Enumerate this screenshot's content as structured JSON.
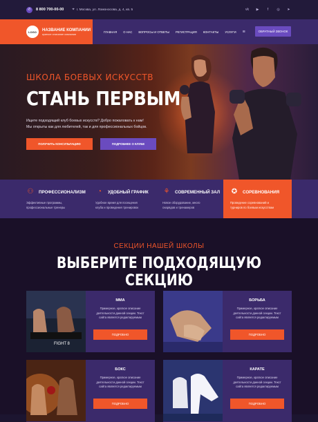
{
  "topbar": {
    "phone": "8 800 700-00-00",
    "address": "г. Москва, ул. Ломоносова, д. 4, кв. 5",
    "socials": [
      "vk-icon",
      "youtube-icon",
      "facebook-icon",
      "instagram-icon",
      "telegram-icon"
    ]
  },
  "brand": {
    "logo": "LOGO",
    "name": "НАЗВАНИЕ КОМПАНИИ",
    "tagline": "краткое описание компании"
  },
  "menu": {
    "items": [
      "ГЛАВНАЯ",
      "О НАС",
      "ВОПРОСЫ И ОТВЕТЫ",
      "РЕГИСТРАЦИЯ",
      "КОНТАКТЫ",
      "УСЛУГИ"
    ],
    "callback": "ОБРАТНЫЙ ЗВОНОК"
  },
  "hero": {
    "kicker": "ШКОЛА БОЕВЫХ ИСКУССТВ",
    "title": "СТАНЬ ПЕРВЫМ",
    "text_line1": "Ищете подходящий клуб боевых искусств? Добро пожаловать к нам!",
    "text_line2": "Мы открыты как для любителей, так и для профессиональных бойцов.",
    "btn_primary": "ПОЛУЧИТЬ КОНСУЛЬТАЦИЮ",
    "btn_secondary": "ПОДРОБНЕЕ О КЛУБЕ"
  },
  "features": [
    {
      "title": "ПРОФЕССИОНАЛИЗМ",
      "line1": "Эффективные программы,",
      "line2": "профессиональные тренеры"
    },
    {
      "title": "УДОБНЫЙ ГРАФИК",
      "line1": "Удобное время для посещения",
      "line2": "клуба и проведения тренировок"
    },
    {
      "title": "СОВРЕМЕННЫЙ ЗАЛ",
      "line1": "Новое оборудование, много",
      "line2": "снарядов и тренажеров"
    },
    {
      "title": "СОРЕВНОВАНИЯ",
      "line1": "Проведение соревнований и",
      "line2": "турниров по боевым искусствам"
    }
  ],
  "sections": {
    "kicker": "СЕКЦИИ НАШЕЙ ШКОЛЫ",
    "title": "ВЫБЕРИТЕ ПОДХОДЯЩУЮ СЕКЦИЮ",
    "cards": [
      {
        "title": "ММА",
        "line1": "Примерное, краткое описание",
        "line2": "деятельности данной секции. Текст",
        "line3": "сайта является редактируемым",
        "button": "ПОДРОБНО"
      },
      {
        "title": "БОРЬБА",
        "line1": "Примерное, краткое описание",
        "line2": "деятельности данной секции. Текст",
        "line3": "сайта является редактируемым",
        "button": "ПОДРОБНО"
      },
      {
        "title": "БОКС",
        "line1": "Примерное, краткое описание",
        "line2": "деятельности данной секции. Текст",
        "line3": "сайта является редактируемым",
        "button": "ПОДРОБНО"
      },
      {
        "title": "КАРАТЕ",
        "line1": "Примерное, краткое описание",
        "line2": "деятельности данной секции. Текст",
        "line3": "сайта является редактируемым",
        "button": "ПОДРОБНО"
      }
    ],
    "mma_photo_text": "FIGHT 8"
  },
  "colors": {
    "accent": "#f0562a",
    "purple": "#6a4bbf",
    "nav": "#3b2a6b",
    "bg": "#1a1028"
  }
}
